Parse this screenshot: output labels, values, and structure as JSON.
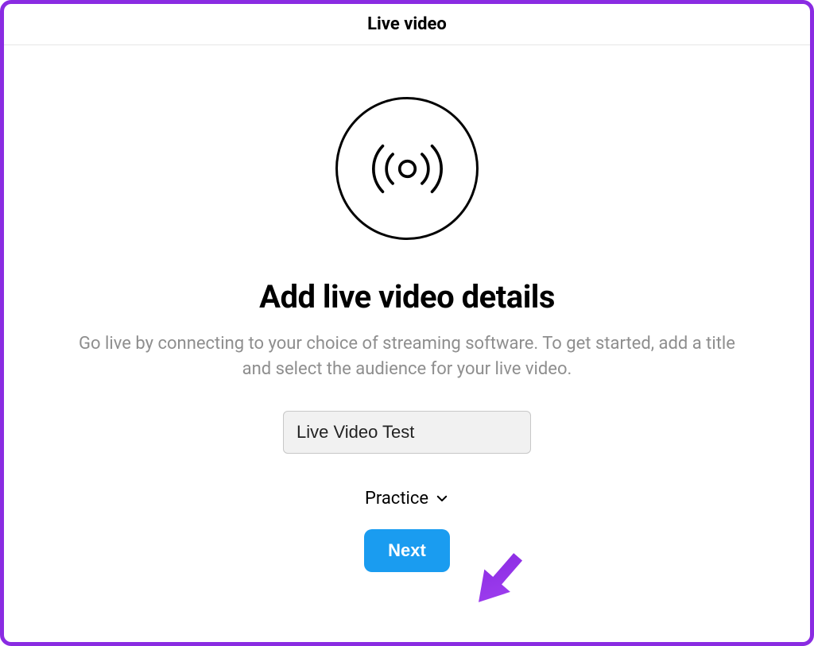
{
  "header": {
    "title": "Live video"
  },
  "main": {
    "heading": "Add live video details",
    "description": "Go live by connecting to your choice of streaming software. To get started, add a title and select the audience for your live video.",
    "title_input_value": "Live Video Test",
    "audience_selected": "Practice",
    "next_label": "Next"
  },
  "colors": {
    "accent": "#1a9cf0",
    "annotation": "#8a2be2"
  }
}
